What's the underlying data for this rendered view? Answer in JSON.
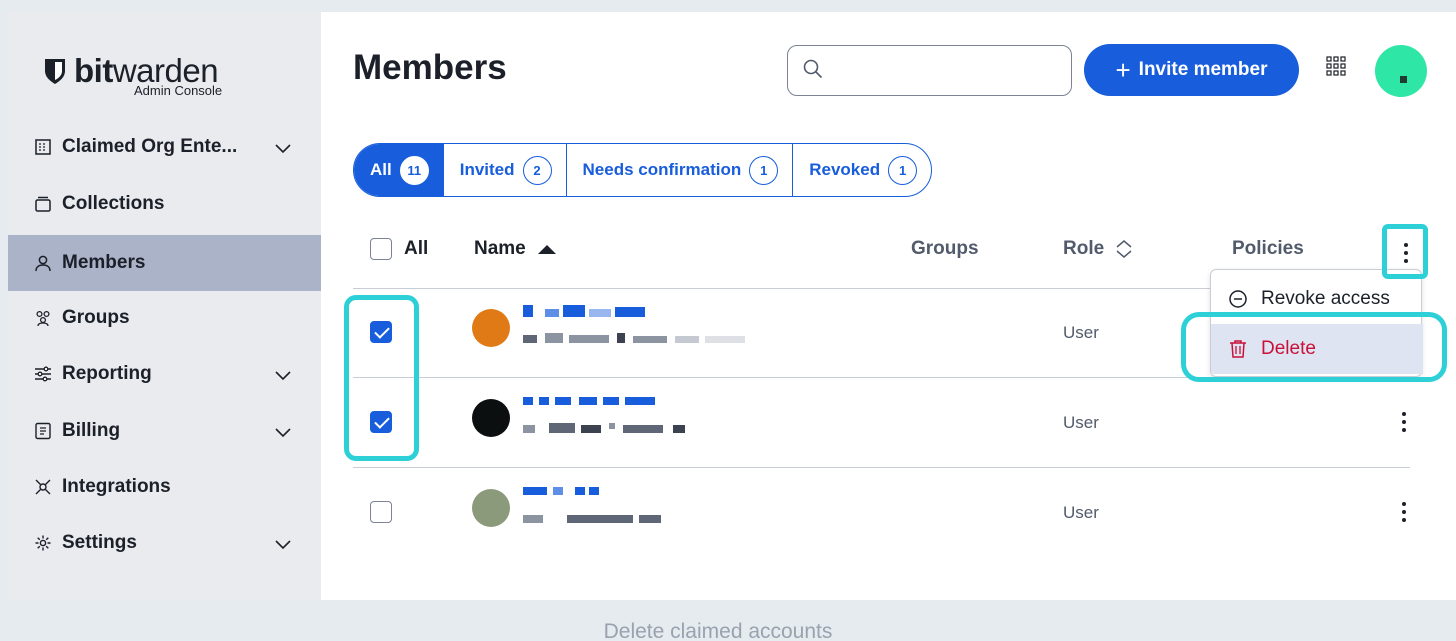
{
  "brand": {
    "name_bold": "bit",
    "name_light": "warden",
    "subtitle": "Admin Console"
  },
  "sidebar": {
    "items": [
      {
        "label": "Claimed Org Ente...",
        "icon": "building-icon",
        "expandable": true,
        "active": false
      },
      {
        "label": "Collections",
        "icon": "collection-icon",
        "expandable": false,
        "active": false
      },
      {
        "label": "Members",
        "icon": "user-icon",
        "expandable": false,
        "active": true
      },
      {
        "label": "Groups",
        "icon": "groups-icon",
        "expandable": false,
        "active": false
      },
      {
        "label": "Reporting",
        "icon": "sliders-icon",
        "expandable": true,
        "active": false
      },
      {
        "label": "Billing",
        "icon": "billing-icon",
        "expandable": true,
        "active": false
      },
      {
        "label": "Integrations",
        "icon": "integrations-icon",
        "expandable": false,
        "active": false
      },
      {
        "label": "Settings",
        "icon": "gear-icon",
        "expandable": true,
        "active": false
      }
    ]
  },
  "header": {
    "title": "Members",
    "search": {
      "placeholder": "",
      "value": ""
    },
    "invite_label": "Invite member"
  },
  "tabs": [
    {
      "label": "All",
      "count": "11",
      "active": true
    },
    {
      "label": "Invited",
      "count": "2",
      "active": false
    },
    {
      "label": "Needs confirmation",
      "count": "1",
      "active": false
    },
    {
      "label": "Revoked",
      "count": "1",
      "active": false
    }
  ],
  "table": {
    "columns": {
      "select_all": "All",
      "name": "Name",
      "groups": "Groups",
      "role": "Role",
      "policies": "Policies"
    },
    "rows": [
      {
        "checked": true,
        "role": "User",
        "avatar_color": "#e07a16"
      },
      {
        "checked": true,
        "role": "User",
        "avatar_color": "#0b0f10"
      },
      {
        "checked": false,
        "role": "User",
        "avatar_color": "#8c9a7c"
      }
    ]
  },
  "menu": {
    "items": [
      {
        "label": "Revoke access",
        "icon": "minus-circle-icon"
      },
      {
        "label": "Delete",
        "icon": "trash-icon"
      }
    ]
  },
  "colors": {
    "accent": "#175ddc",
    "danger": "#c8103a",
    "highlight": "#2ed0d8"
  },
  "caption": "Delete claimed accounts"
}
